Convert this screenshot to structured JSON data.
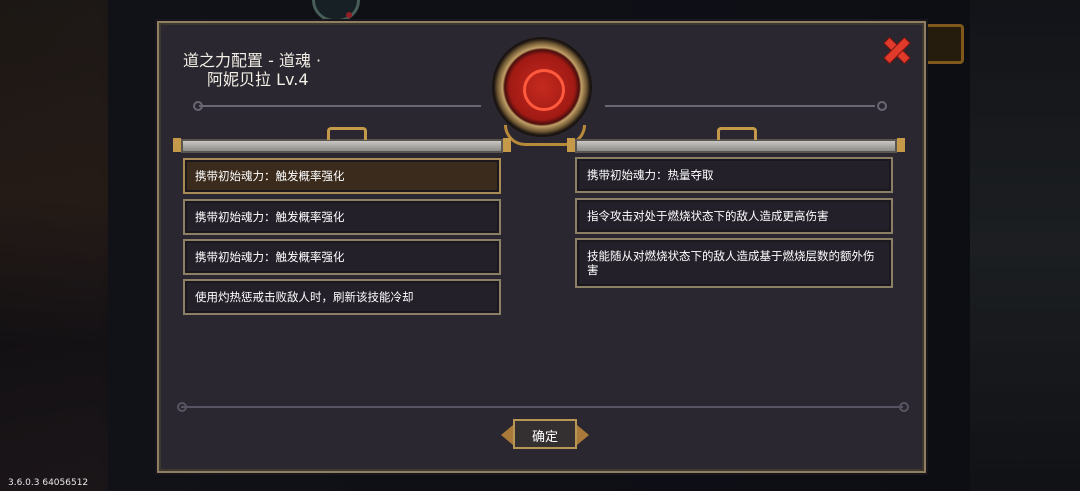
{
  "version": "3.6.0.3 64056512",
  "dialog": {
    "title_line1": "道之力配置 - 道魂 ·",
    "title_line2": "阿妮贝拉 Lv.4",
    "close_icon": "close-x-icon",
    "emblem_icon": "soul-portrait-icon",
    "accent_color": "#e03a2a",
    "frame_color": "#8e7f62"
  },
  "left_slots": [
    {
      "text": "携带初始魂力：触发概率强化",
      "selected": true
    },
    {
      "text": "携带初始魂力：触发概率强化",
      "selected": false
    },
    {
      "text": "携带初始魂力：触发概率强化",
      "selected": false
    },
    {
      "text": "使用灼热惩戒击败敌人时，刷新该技能冷却",
      "selected": false
    }
  ],
  "right_slots": [
    {
      "text": "携带初始魂力：热量夺取"
    },
    {
      "text": "指令攻击对处于燃烧状态下的敌人造成更高伤害"
    },
    {
      "text": "技能随从对燃烧状态下的敌人造成基于燃烧层数的额外伤害"
    }
  ],
  "confirm_label": "确定"
}
